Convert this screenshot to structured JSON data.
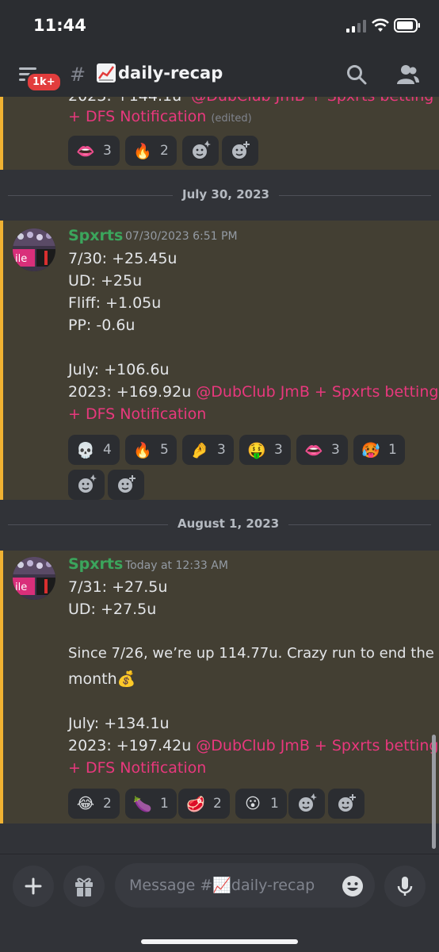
{
  "status_bar": {
    "time": "11:44"
  },
  "header": {
    "unread_badge": "1k+",
    "channel_hash": "#",
    "channel_name": "daily-recap",
    "channel_emoji": "chart-increasing-icon"
  },
  "messages": {
    "partial_top": {
      "line_fragment": "2023: +144.1u",
      "mention_fragment": "@DubClub JmB + Spxrts betting",
      "mention_end": "+ DFS Notification",
      "edited": "(edited)",
      "reactions": [
        {
          "emoji": "👄",
          "count": "3"
        },
        {
          "emoji": "🔥",
          "count": "2"
        }
      ]
    },
    "divider_1": "July 30, 2023",
    "msg_1": {
      "author": "Spxrts",
      "timestamp": "07/30/2023 6:51 PM",
      "lines": [
        "7/30: +25.45u",
        "UD: +25u",
        "Fliff: +1.05u",
        "PP: -0.6u",
        "",
        "July: +106.6u"
      ],
      "last_prefix": "2023: +169.92u ",
      "mention": "@DubClub JmB + Spxrts betting",
      "mention_end": "+ DFS Notification",
      "reactions": [
        {
          "emoji": "💀",
          "count": "4"
        },
        {
          "emoji": "🔥",
          "count": "5"
        },
        {
          "emoji": "🤌",
          "count": "3"
        },
        {
          "emoji": "🤑",
          "count": "3"
        },
        {
          "emoji": "👄",
          "count": "3"
        },
        {
          "emoji": "🥵",
          "count": "1"
        }
      ]
    },
    "divider_2": "August 1, 2023",
    "msg_2": {
      "author": "Spxrts",
      "timestamp": "Today at 12:33 AM",
      "lines": [
        "7/31: +27.5u",
        "UD: +27.5u",
        "",
        "Since 7/26, we’re up 114.77u. Crazy run to end the",
        "month💰",
        "",
        "July: +134.1u"
      ],
      "last_prefix": "2023: +197.42u ",
      "mention": "@DubClub JmB + Spxrts betting",
      "mention_end": "+ DFS Notification",
      "reactions": [
        {
          "emoji": "😂",
          "count": "2"
        },
        {
          "emoji": "🍆",
          "count": "1"
        },
        {
          "emoji": "🥩",
          "count": "2"
        },
        {
          "emoji": "😮",
          "count": "1"
        }
      ]
    }
  },
  "input": {
    "placeholder": "Message #📈daily-recap"
  },
  "colors": {
    "mention": "#e8387d",
    "author": "#3ba55c",
    "highlight_bar": "#f0b232"
  }
}
